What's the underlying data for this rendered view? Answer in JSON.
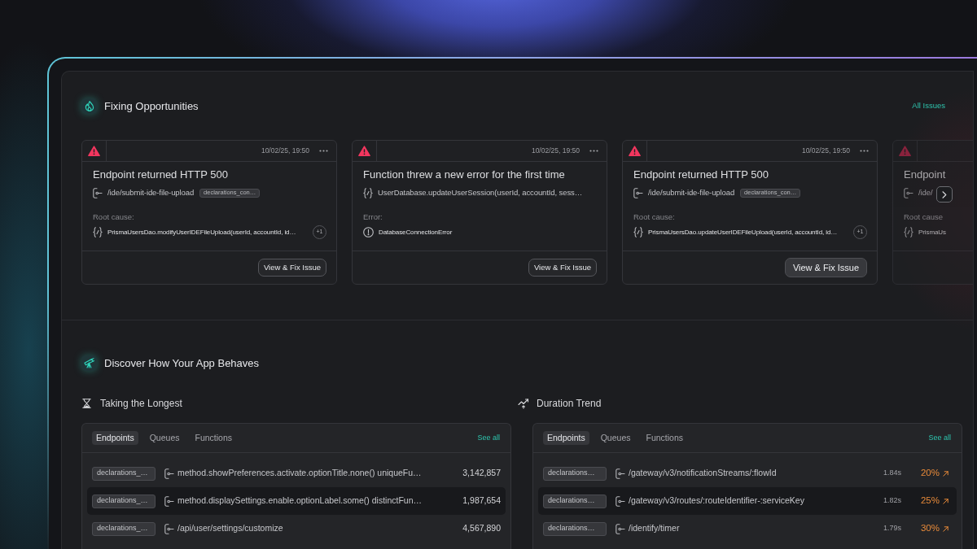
{
  "fixing": {
    "title": "Fixing Opportunities",
    "link": "All Issues",
    "cards": [
      {
        "faded": false,
        "timestamp": "10/02/25, 19:50",
        "title": "Endpoint returned HTTP 500",
        "subject": {
          "kind": "endpoint",
          "text": "/ide/submit-ide-file-upload",
          "tag": "declarations_con…"
        },
        "cause_label": "Root cause:",
        "cause": {
          "kind": "function",
          "text": "PrismaUsersDao.modifyUserIDEFileUpload(userId, accountId, id…",
          "extra": "+1"
        },
        "button": {
          "label": "View & Fix Issue",
          "highlighted": false
        }
      },
      {
        "faded": false,
        "timestamp": "10/02/25, 19:50",
        "title": "Function threw a new error for the first time",
        "subject": {
          "kind": "function",
          "text": "UserDatabase.updateUserSession(userId, accountId, sess…"
        },
        "cause_label": "Error:",
        "cause": {
          "kind": "error",
          "text": "DatabaseConnectionError"
        },
        "button": {
          "label": "View & Fix Issue",
          "highlighted": false
        }
      },
      {
        "faded": false,
        "timestamp": "10/02/25, 19:50",
        "title": "Endpoint returned HTTP 500",
        "subject": {
          "kind": "endpoint",
          "text": "/ide/submit-ide-file-upload",
          "tag": "declarations_con…"
        },
        "cause_label": "Root cause:",
        "cause": {
          "kind": "function",
          "text": "PrismaUsersDao.updateUserIDEFileUpload(userId, accountId, id…",
          "extra": "+1"
        },
        "button": {
          "label": "View & Fix Issue",
          "highlighted": true
        }
      },
      {
        "faded": true,
        "title": "Endpoint",
        "subject": {
          "kind": "endpoint",
          "text": "/ide/"
        },
        "cause_label": "Root cause",
        "cause": {
          "kind": "function",
          "text": "PrismaUs"
        }
      }
    ]
  },
  "discover": {
    "title": "Discover How Your App Behaves",
    "panels": [
      {
        "kind": "longest",
        "title": "Taking the Longest",
        "tabs": [
          {
            "label": "Endpoints",
            "selected": true
          },
          {
            "label": "Queues",
            "selected": false
          },
          {
            "label": "Functions",
            "selected": false
          }
        ],
        "link": "See all",
        "rows": [
          {
            "tag": "declarations_…",
            "text": "method.showPreferences.activate.optionTitle.none() uniqueFu…",
            "value": "3,142,857",
            "highlighted": false
          },
          {
            "tag": "declarations_…",
            "text": "method.displaySettings.enable.optionLabel.some() distinctFun…",
            "value": "1,987,654",
            "highlighted": true
          },
          {
            "tag": "declarations_…",
            "text": "/api/user/settings/customize",
            "value": "4,567,890",
            "highlighted": false
          }
        ]
      },
      {
        "kind": "trend",
        "title": "Duration Trend",
        "tabs": [
          {
            "label": "Endpoints",
            "selected": true
          },
          {
            "label": "Queues",
            "selected": false
          },
          {
            "label": "Functions",
            "selected": false
          }
        ],
        "link": "See all",
        "rows": [
          {
            "tag": "declarations…",
            "text": "/gateway/v3/notificationStreams/:flowId",
            "duration": "1.84s",
            "change": "20%",
            "highlighted": false
          },
          {
            "tag": "declarations…",
            "text": "/gateway/v3/routes/:routeIdentifier-:serviceKey",
            "duration": "1.82s",
            "change": "25%",
            "highlighted": true
          },
          {
            "tag": "declarations…",
            "text": "/identify/timer",
            "duration": "1.79s",
            "change": "30%",
            "highlighted": false
          }
        ]
      }
    ]
  }
}
